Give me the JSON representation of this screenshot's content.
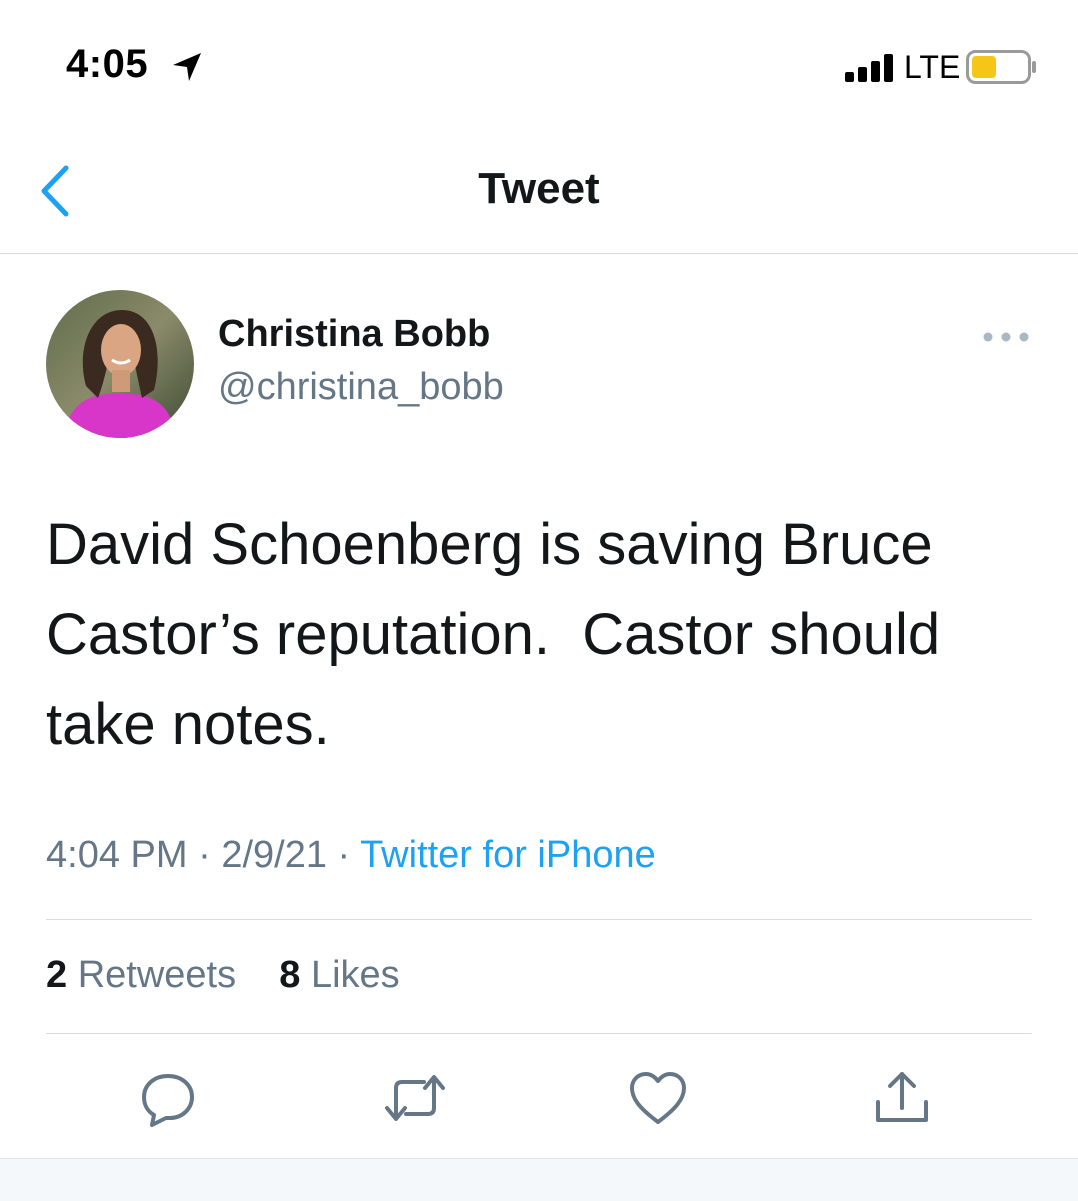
{
  "status_bar": {
    "time": "4:05",
    "network": "LTE"
  },
  "nav": {
    "title": "Tweet"
  },
  "tweet": {
    "author_name": "Christina Bobb",
    "author_handle": "@christina_bobb",
    "text": "David Schoenberg is saving Bruce\nCastor’s reputation.  Castor should\ntake notes.",
    "time": "4:04 PM",
    "date": "2/9/21",
    "separator": " · ",
    "source": "Twitter for iPhone",
    "retweets_count": "2",
    "retweets_label": "Retweets",
    "likes_count": "8",
    "likes_label": "Likes"
  },
  "icons": {
    "location": "location-arrow-icon",
    "signal": "signal-bars-icon",
    "battery": "battery-icon",
    "back": "chevron-left-icon",
    "more": "more-dots-icon",
    "reply": "reply-icon",
    "retweet": "retweet-icon",
    "like": "heart-icon",
    "share": "share-icon"
  },
  "colors": {
    "accent": "#1da1f2",
    "secondary_text": "#657786",
    "primary_text": "#14171a",
    "battery_fill": "#f5c518"
  }
}
